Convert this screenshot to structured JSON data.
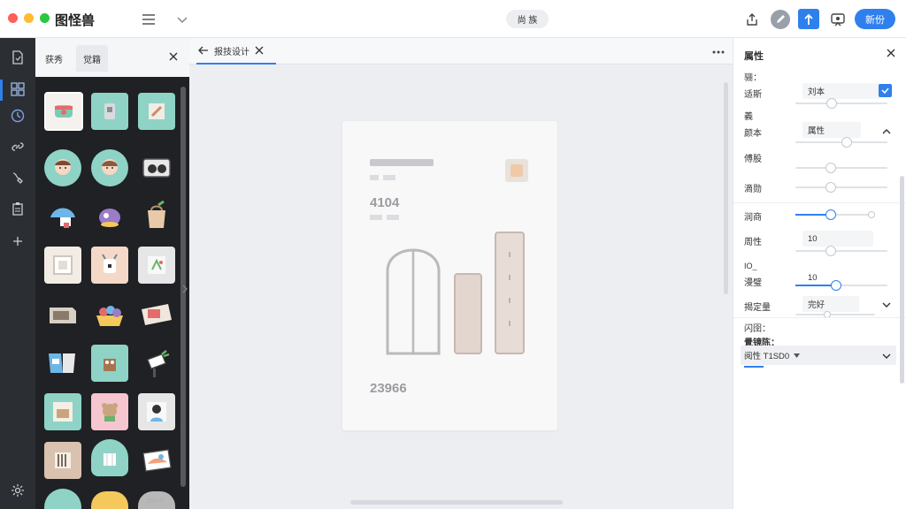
{
  "app": {
    "title": "图怪兽",
    "center_pill_label": "尚 族",
    "primary_button_label": "新份"
  },
  "library": {
    "tabs": [
      {
        "label": "获秀"
      },
      {
        "label": "觉籍"
      }
    ],
    "scroll_caption": "Ctrl+0"
  },
  "document": {
    "tab_label": "报技设计",
    "card": {
      "number_top": "4104",
      "number_bottom": "23966"
    }
  },
  "properties": {
    "title": "属性",
    "section_a": "骊：",
    "row_filter": {
      "label": "适斯",
      "value": "刘本"
    },
    "section_b": "義",
    "row_basic": {
      "label": "颜本",
      "value": "属性"
    },
    "row_offset": {
      "label": "傅股"
    },
    "row_blur": {
      "label": "滴勋"
    },
    "row_opacity": {
      "label": "润商"
    },
    "row_attr": {
      "label": "周性",
      "value": "10"
    },
    "row_size_caption": "IO_",
    "row_spacing": {
      "label": "漫璧",
      "value": "10"
    },
    "row_style": {
      "label": "揭定量",
      "value": "完好"
    },
    "footer_label_1": "闪囹：",
    "footer_label_2": "覺镜陈：",
    "footer_select": "阅性 T1SD0"
  },
  "colors": {
    "accent": "#2f80ed",
    "rail_bg": "#2b2e33",
    "library_bg": "#1f2124"
  }
}
